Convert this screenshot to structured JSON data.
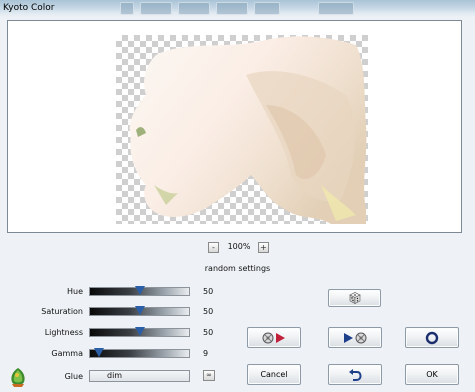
{
  "window": {
    "title": "Kyoto Color"
  },
  "zoom": {
    "minus_label": "-",
    "value": "100%",
    "plus_label": "+"
  },
  "random_settings_label": "random settings",
  "sliders": [
    {
      "label": "Hue",
      "value": "50",
      "level": 0.5
    },
    {
      "label": "Saturation",
      "value": "50",
      "level": 0.5
    },
    {
      "label": "Lightness",
      "value": "50",
      "level": 0.5
    },
    {
      "label": "Gamma",
      "value": "9",
      "level": 0.09
    }
  ],
  "glue": {
    "label": "Glue",
    "value": "dim",
    "link_label": "∞"
  },
  "buttons": {
    "cancel_label": "Cancel",
    "ok_label": "OK"
  },
  "icons": {
    "random": "dice-icon",
    "prev": "reel-back-icon",
    "next": "reel-forward-icon",
    "reset": "ring-icon",
    "undo": "undo-arrow-icon",
    "logo": "filter-logo-icon"
  }
}
